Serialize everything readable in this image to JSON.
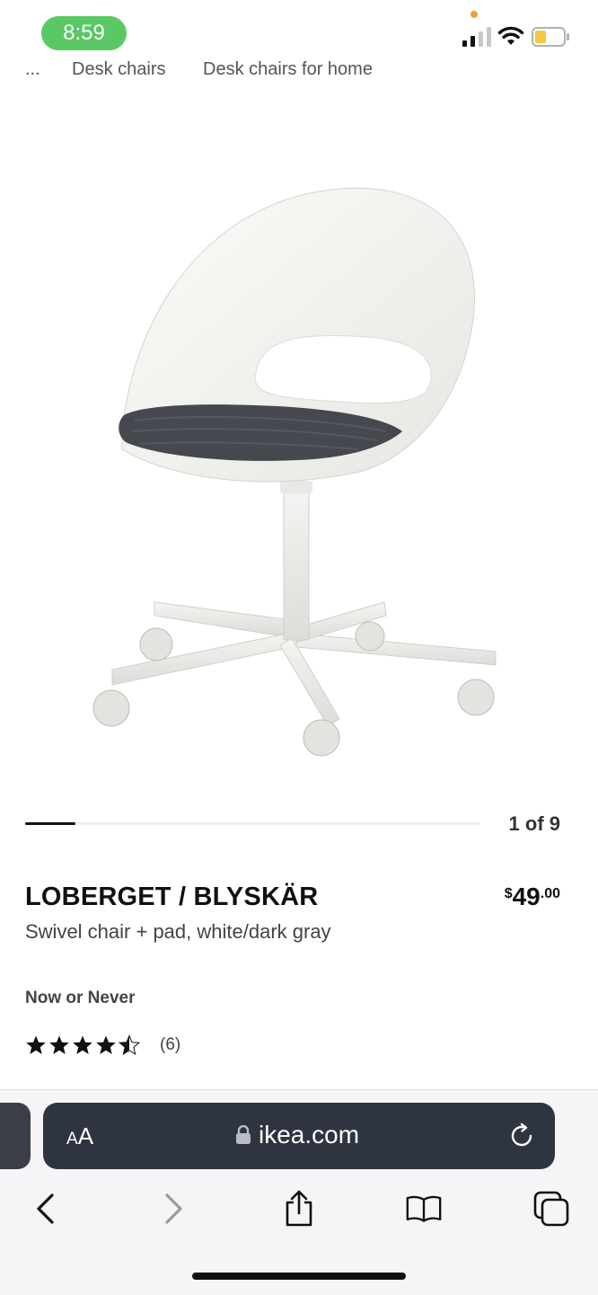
{
  "status_bar": {
    "time": "8:59",
    "icons": [
      "cellular-signal-icon",
      "wifi-icon",
      "battery-icon"
    ],
    "time_pill_color": "#5ac864",
    "battery_fill_color": "#f5c842"
  },
  "breadcrumb": {
    "items": [
      "...",
      "Desk chairs",
      "Desk chairs for home"
    ]
  },
  "carousel": {
    "count_label": "1 of 9"
  },
  "product": {
    "title": "LOBERGET / BLYSKÄR",
    "description": "Swivel chair + pad, white/dark gray",
    "price": {
      "currency": "$",
      "integer": "49",
      "decimal": ".00"
    },
    "promo_label": "Now or Never",
    "rating": {
      "value": 4.5,
      "max": 5,
      "count_label": "(6)"
    }
  },
  "browser": {
    "aa_label_small": "A",
    "aa_label_large": "A",
    "url": "ikea.com",
    "toolbar_icons": [
      "back-icon",
      "forward-icon",
      "share-icon",
      "bookmarks-icon",
      "tabs-icon"
    ]
  }
}
